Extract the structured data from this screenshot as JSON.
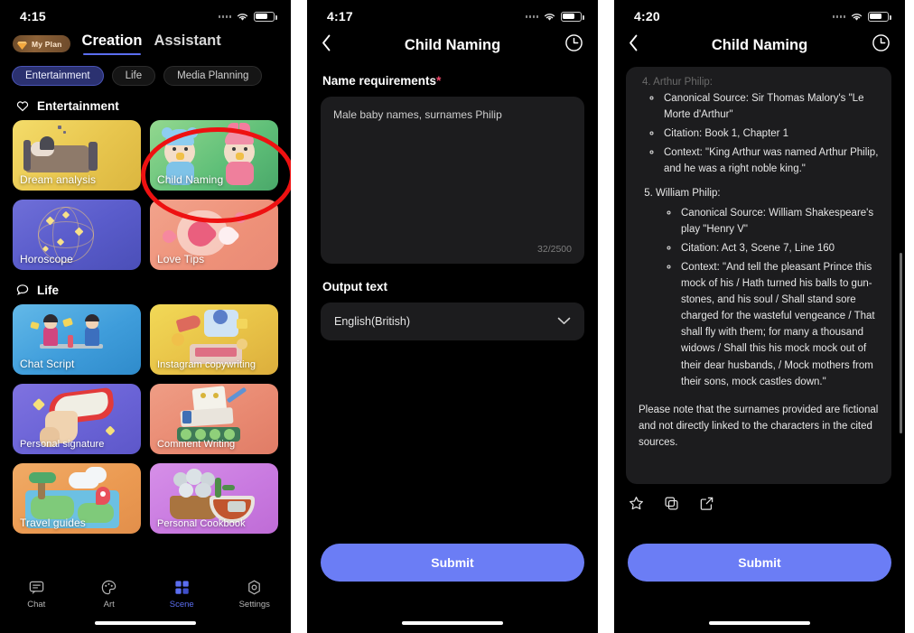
{
  "panel1": {
    "status": {
      "time": "4:15",
      "wifi_icon": "wifi-icon",
      "battery_icon": "battery-icon"
    },
    "my_plan_badge": {
      "label": "My Plan",
      "icon": "gem-icon"
    },
    "tabs": [
      {
        "label": "Creation",
        "active": true
      },
      {
        "label": "Assistant",
        "active": false
      }
    ],
    "chips": [
      {
        "label": "Entertainment",
        "selected": true
      },
      {
        "label": "Life",
        "selected": false
      },
      {
        "label": "Media Planning",
        "selected": false
      }
    ],
    "sections": [
      {
        "title": "Entertainment",
        "icon": "heart-icon",
        "cards": [
          {
            "label": "Dream analysis",
            "art": "a-dream"
          },
          {
            "label": "Child Naming",
            "art": "a-child",
            "highlighted": true
          },
          {
            "label": "Horoscope",
            "art": "a-horo"
          },
          {
            "label": "Love Tips",
            "art": "a-love"
          }
        ]
      },
      {
        "title": "Life",
        "icon": "speech-bubble-icon",
        "cards": [
          {
            "label": "Chat Script",
            "art": "a-chat"
          },
          {
            "label": "Instagram copywriting",
            "art": "a-insta"
          },
          {
            "label": "Personal signature",
            "art": "a-sign"
          },
          {
            "label": "Comment Writing",
            "art": "a-comm"
          },
          {
            "label": "Travel guides",
            "art": "a-trav"
          },
          {
            "label": "Personal Cookbook",
            "art": "a-cook"
          }
        ]
      }
    ],
    "tabbar": [
      {
        "label": "Chat",
        "icon": "chat-icon",
        "active": false
      },
      {
        "label": "Art",
        "icon": "palette-icon",
        "active": false
      },
      {
        "label": "Scene",
        "icon": "grid-icon",
        "active": true
      },
      {
        "label": "Settings",
        "icon": "gear-icon",
        "active": false
      }
    ],
    "accent": "#5b6ef0"
  },
  "panel2": {
    "status": {
      "time": "4:17"
    },
    "nav": {
      "back_icon": "chevron-left-icon",
      "title": "Child Naming",
      "history_icon": "clock-icon"
    },
    "name_requirements": {
      "label": "Name requirements",
      "required_mark": "*",
      "value": "Male baby names, surnames Philip",
      "counter": "32/2500"
    },
    "output_text": {
      "label": "Output text",
      "value": "English(British)",
      "chevron_icon": "chevron-down-icon"
    },
    "submit_label": "Submit"
  },
  "panel3": {
    "status": {
      "time": "4:20"
    },
    "nav": {
      "back_icon": "chevron-left-icon",
      "title": "Child Naming",
      "history_icon": "clock-icon"
    },
    "answer": {
      "clipped_top": "4. Arthur Philip:",
      "items": [
        {
          "number": "4.",
          "name": "Arthur Philip:",
          "subs": [
            "Canonical Source: Sir Thomas Malory's \"Le Morte d'Arthur\"",
            "Citation: Book 1, Chapter 1",
            "Context: \"King Arthur was named Arthur Philip, and he was a right noble king.\""
          ]
        },
        {
          "number": "5.",
          "name": "William Philip:",
          "subs": [
            "Canonical Source: William Shakespeare's play \"Henry V\"",
            "Citation: Act 3, Scene 7, Line 160",
            "Context: \"And tell the pleasant Prince this mock of his / Hath turned his balls to gun-stones, and his soul / Shall stand sore charged for the wasteful vengeance / That shall fly with them; for many a thousand widows / Shall this his mock mock out of their dear husbands, / Mock mothers from their sons, mock castles down.\""
          ]
        }
      ],
      "note": "Please note that the surnames provided are fictional and not directly linked to the characters in the cited sources."
    },
    "actions": [
      {
        "icon": "star-icon"
      },
      {
        "icon": "copy-icon"
      },
      {
        "icon": "share-icon"
      }
    ],
    "submit_label": "Submit"
  }
}
